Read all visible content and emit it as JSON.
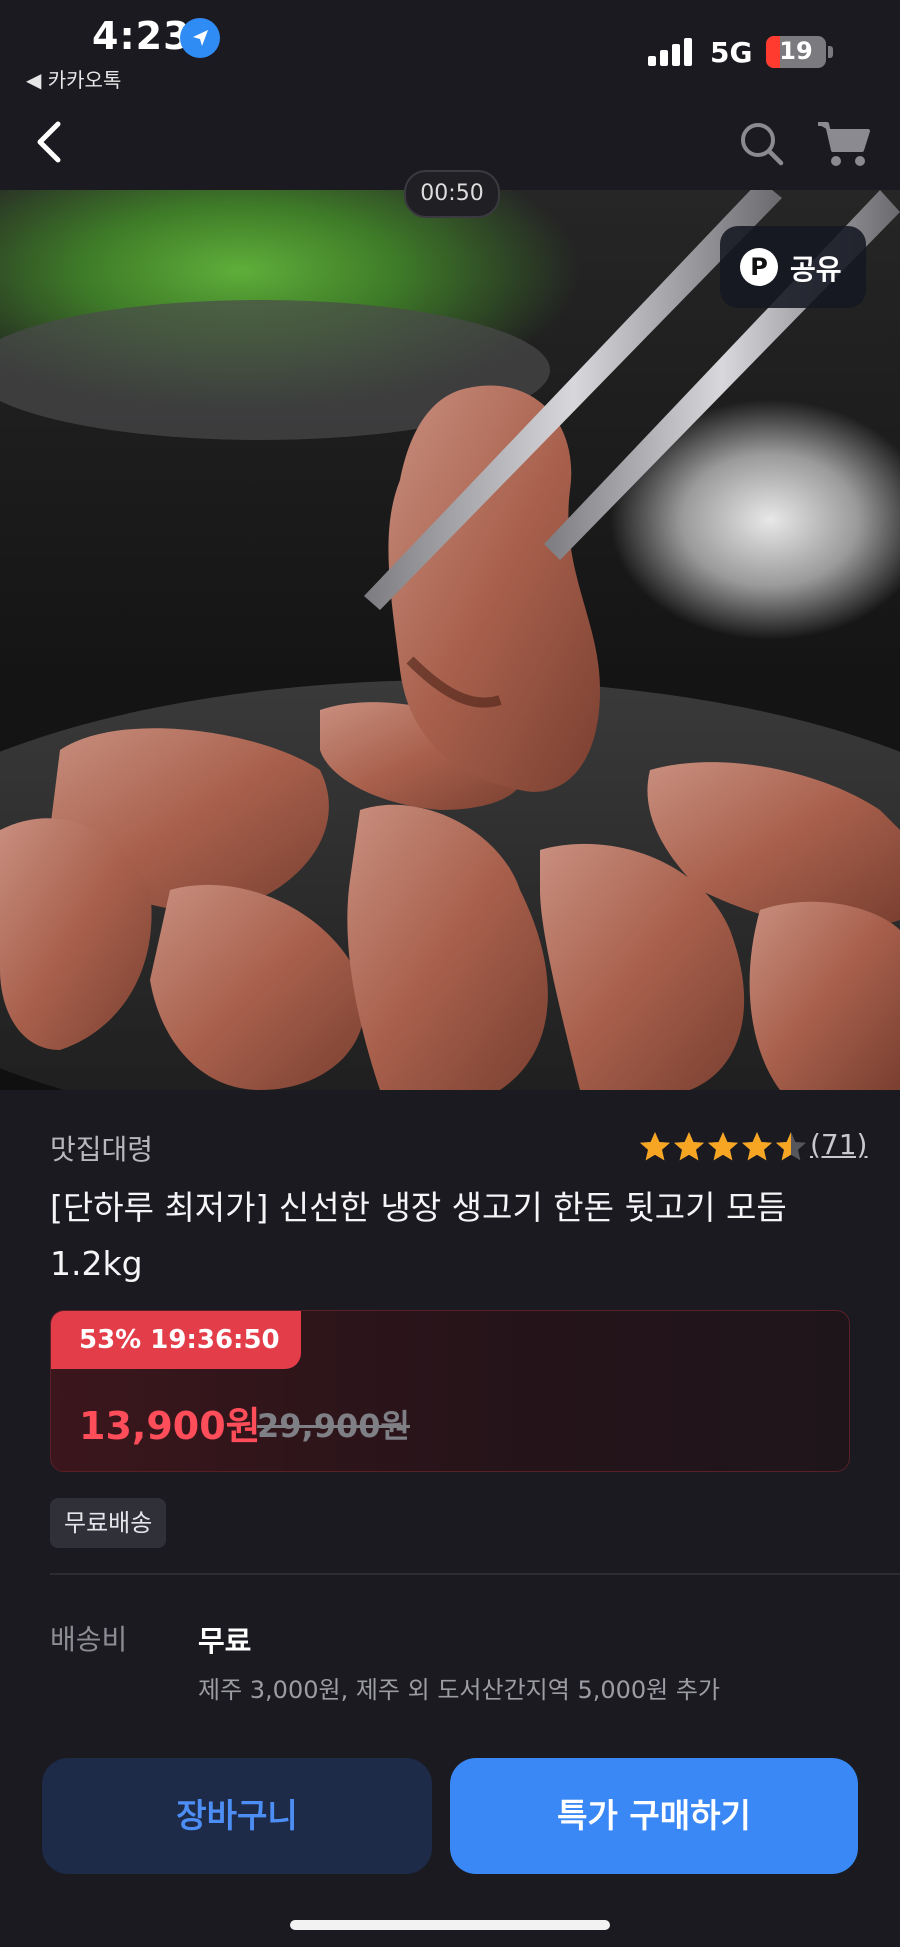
{
  "status_bar": {
    "time": "4:23",
    "back_app": "◀ 카카오톡",
    "network": "5G",
    "battery": "19"
  },
  "nav": {
    "back_icon": "chevron-left-icon",
    "search_icon": "search-icon",
    "cart_icon": "cart-icon"
  },
  "media": {
    "timer": "00:50",
    "share_badge": "P",
    "share_label": "공유"
  },
  "product": {
    "seller": "맛집대령",
    "rating": 4.5,
    "rating_max": 5,
    "review_count": "(71)",
    "title": "[단하루 최저가] 신선한 냉장 생고기 한돈 뒷고기 모듬 1.2kg"
  },
  "price": {
    "sale_tag": "53% 19:36:50",
    "current": "13,900원",
    "original": "29,900원"
  },
  "badges": {
    "free_shipping": "무료배송"
  },
  "shipping": {
    "label": "배송비",
    "value": "무료",
    "note": "제주 3,000원, 제주 외 도서산간지역 5,000원 추가"
  },
  "actions": {
    "cart": "장바구니",
    "buy": "특가 구매하기"
  },
  "colors": {
    "accent_blue": "#3a88f5",
    "sale_red": "#e33d4a",
    "star": "#f6a623",
    "background": "#1a1a20"
  }
}
